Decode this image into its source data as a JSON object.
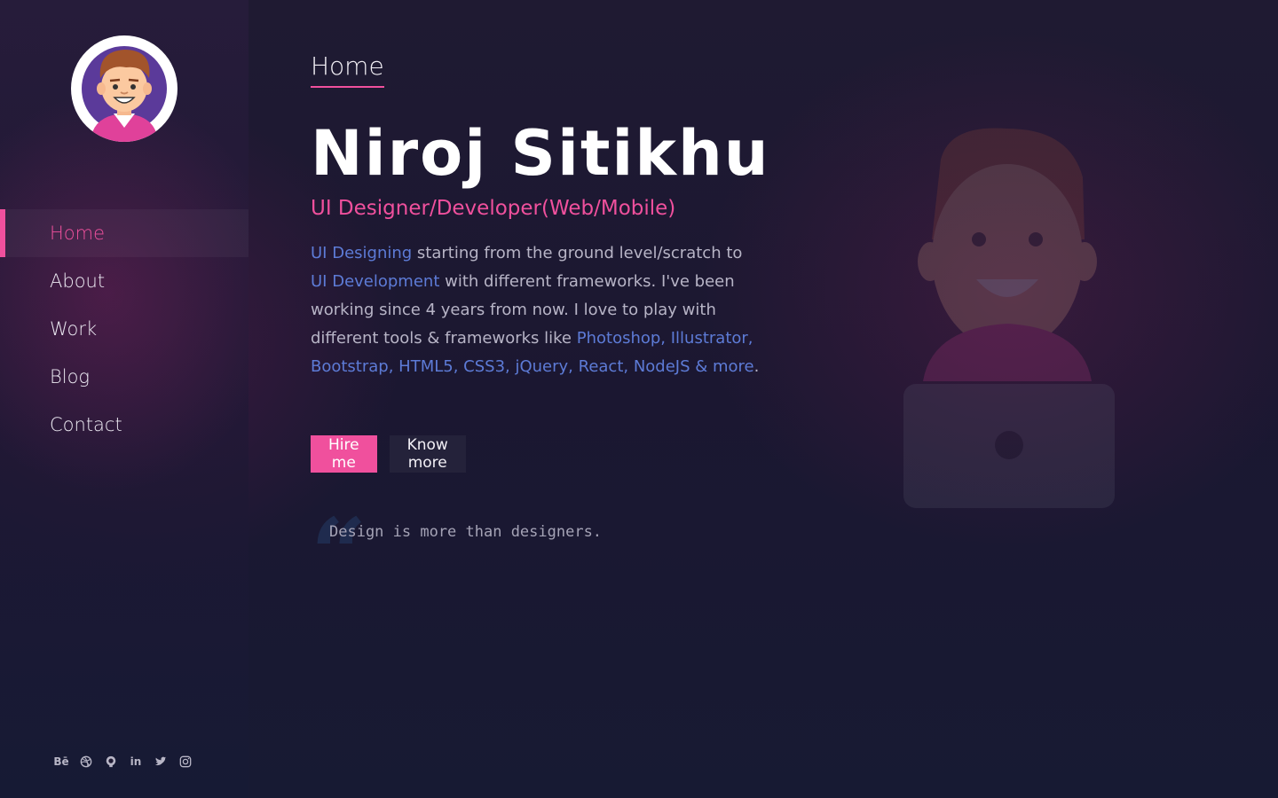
{
  "sidebar": {
    "avatar_alt": "avatar",
    "nav": [
      {
        "label": "Home",
        "active": true
      },
      {
        "label": "About",
        "active": false
      },
      {
        "label": "Work",
        "active": false
      },
      {
        "label": "Blog",
        "active": false
      },
      {
        "label": "Contact",
        "active": false
      }
    ],
    "social": [
      {
        "icon": "behance-icon",
        "label": "Bē"
      },
      {
        "icon": "dribbble-icon"
      },
      {
        "icon": "github-icon"
      },
      {
        "icon": "linkedin-icon",
        "label": "in"
      },
      {
        "icon": "twitter-icon"
      },
      {
        "icon": "instagram-icon"
      }
    ]
  },
  "main": {
    "page_title": "Home",
    "name": "Niroj Sitikhu",
    "role": "UI Designer/Developer(Web/Mobile)",
    "bio": {
      "hl1": "UI Designing",
      "t1": " starting from the ground level/scratch to ",
      "hl2": "UI Development",
      "t2": " with different frameworks. I've been working since 4 years from now. I love to play with different tools & frameworks like ",
      "hl3": "Photoshop, Illustrator, Bootstrap, HTML5, CSS3, jQuery, React, NodeJS & more",
      "t3": "."
    },
    "buttons": {
      "hire": "Hire me",
      "know_more": "Know more"
    },
    "quote": "Design is more than designers."
  },
  "colors": {
    "accent": "#f0509d",
    "highlight": "#5d7bd6",
    "background": "#1c1830"
  }
}
